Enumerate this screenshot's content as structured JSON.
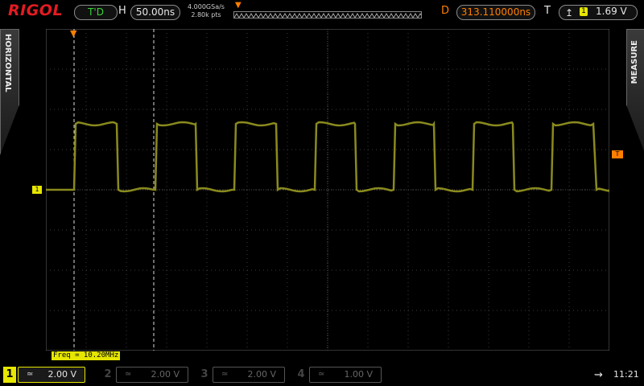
{
  "header": {
    "logo": "RIGOL",
    "trigger_status": "T'D",
    "horizontal_letter": "H",
    "timebase": "50.00ns",
    "sample_rate": "4.000GSa/s",
    "memory_depth": "2.80k pts",
    "delay_letter": "D",
    "delay": "313.110000ns",
    "trigger_letter": "T",
    "trigger_source": "1",
    "trigger_level": "1.69 V"
  },
  "side_tabs": {
    "left": "HORIZONTAL",
    "right": "MEASURE"
  },
  "markers": {
    "ch1": "1",
    "trigger_level": "T"
  },
  "measurement": {
    "freq": "Freq = 10.20MHz"
  },
  "channels": [
    {
      "num": "1",
      "coupling": "≃",
      "scale": "2.00 V"
    },
    {
      "num": "2",
      "coupling": "≃",
      "scale": "2.00 V"
    },
    {
      "num": "3",
      "coupling": "≃",
      "scale": "2.00 V"
    },
    {
      "num": "4",
      "coupling": "≃",
      "scale": "1.00 V"
    }
  ],
  "status": {
    "clock": "11:21",
    "usb_icon": "usb-icon"
  },
  "colors": {
    "ch1": "#e6e600",
    "trace": "#8a8a1e",
    "accent": "#ff7f00",
    "logo": "#e31b23"
  }
}
